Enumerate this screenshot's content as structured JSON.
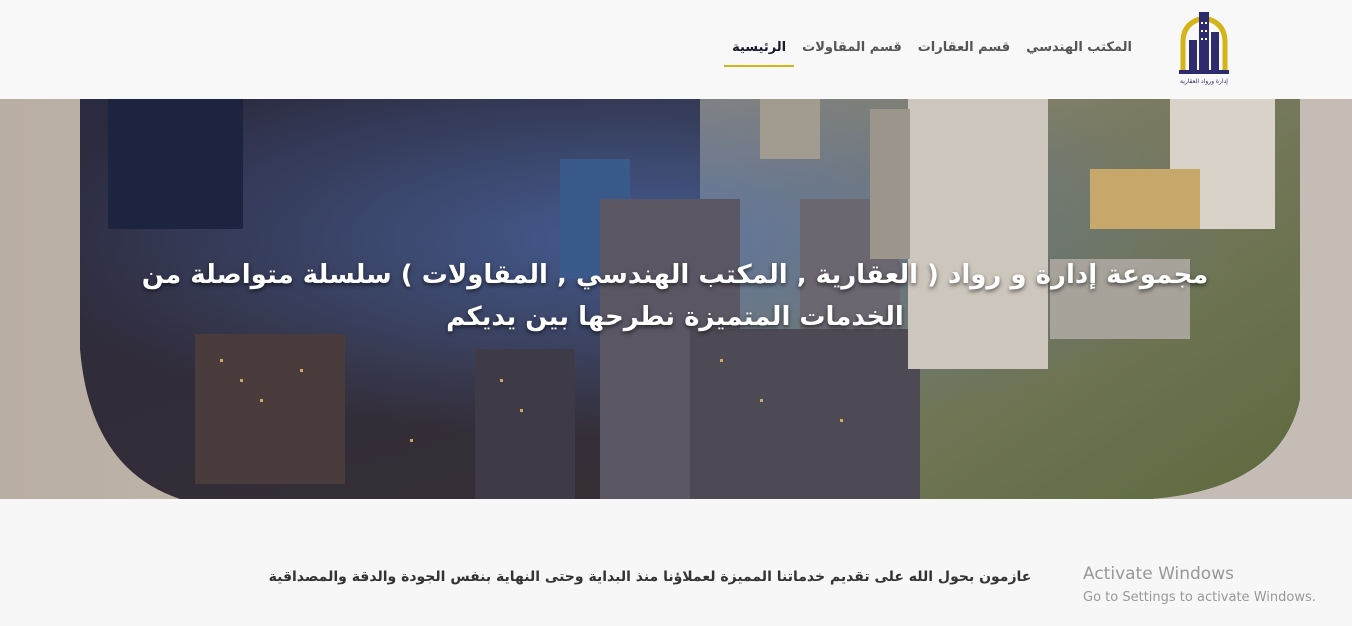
{
  "header": {
    "logo_caption": "إدارة ورواد العقارية",
    "nav": [
      {
        "label": "الرئيسية",
        "active": true
      },
      {
        "label": "قسم المقاولات",
        "active": false
      },
      {
        "label": "قسم العقارات",
        "active": false
      },
      {
        "label": "المكتب الهندسي",
        "active": false
      }
    ]
  },
  "hero": {
    "title": "مجموعة إدارة و رواد ( العقارية , المكتب الهندسي , المقاولات ) سلسلة متواصلة من الخدمات المتميزة نطرحها بين يديكم"
  },
  "content": {
    "tagline": "عازمون بحول الله على تقديم خدماتنا المميزة لعملاؤنا منذ البداية وحتى النهاية بنفس الجودة والدقة والمصداقية"
  },
  "watermark": {
    "title": "Activate Windows",
    "subtitle": "Go to Settings to activate Windows."
  },
  "colors": {
    "accent": "#d4b419",
    "brand": "#2d2a6e"
  }
}
